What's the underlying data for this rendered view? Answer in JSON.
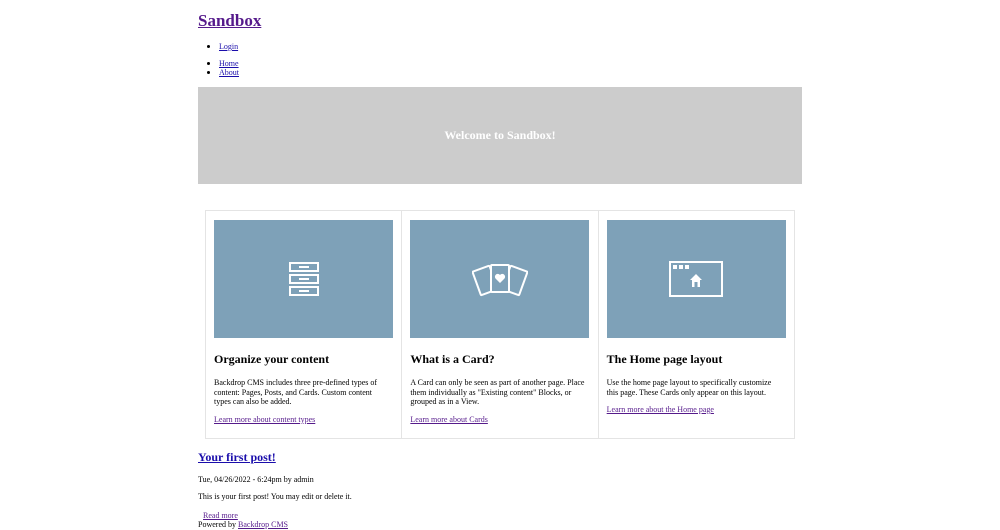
{
  "site": {
    "name": "Sandbox"
  },
  "user_menu": [
    {
      "label": "Login"
    }
  ],
  "main_menu": [
    {
      "label": "Home"
    },
    {
      "label": "About"
    }
  ],
  "hero": {
    "title": "Welcome to Sandbox!"
  },
  "colors": {
    "hero_bg": "#cccccc",
    "card_image_bg": "#7ea1b8",
    "link": "#1a0dab",
    "visited_link": "#551a8b"
  },
  "cards": [
    {
      "icon": "filing-cabinet-icon",
      "title": "Organize your content",
      "text": "Backdrop CMS includes three pre-defined types of content: Pages, Posts, and Cards. Custom content types can also be added.",
      "link": "Learn more about content types"
    },
    {
      "icon": "playing-cards-icon",
      "title": "What is a Card?",
      "text": "A Card can only be seen as part of another page. Place them individually as \"Existing content\" Blocks, or grouped as in a View.",
      "link": "Learn more about Cards"
    },
    {
      "icon": "browser-home-icon",
      "title": "The Home page layout",
      "text": "Use the home page layout to specifically customize this page. These Cards only appear on this layout.",
      "link": "Learn more about the Home page"
    }
  ],
  "post": {
    "title": "Your first post!",
    "meta": "Tue, 04/26/2022 - 6:24pm by admin",
    "body": "This is your first post! You may edit or delete it.",
    "read_more": "Read more"
  },
  "footer": {
    "prefix": "Powered by ",
    "link": "Backdrop CMS"
  }
}
